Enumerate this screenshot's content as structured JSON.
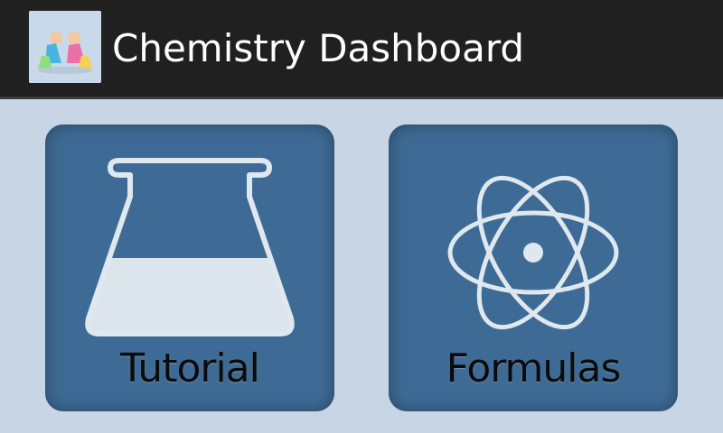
{
  "app_bar": {
    "title": "Chemistry Dashboard",
    "icon": "chemistry-app-icon"
  },
  "dashboard": {
    "tiles": [
      {
        "label": "Tutorial",
        "icon": "flask-icon"
      },
      {
        "label": "Formulas",
        "icon": "atom-icon"
      }
    ]
  },
  "colors": {
    "app_bar_bg": "#202020",
    "content_bg": "#c8d5e5",
    "tile_bg": "#3e6b95",
    "icon_stroke": "#dfe7ef"
  }
}
